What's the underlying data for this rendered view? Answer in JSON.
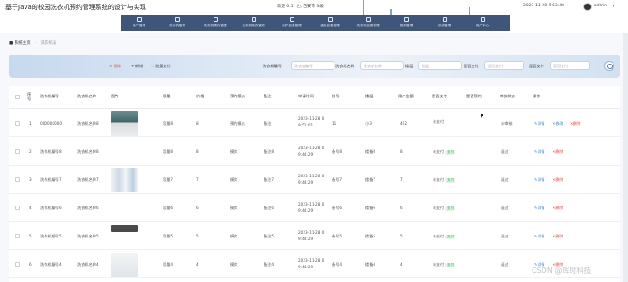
{
  "app": {
    "title": "基于Java的校园洗衣机预约管理系统的设计与实现",
    "user_info": "欢迎 0.1° 🌥 西安市 3级",
    "datetime": "2023-11-28 9:53:40",
    "user": "admin",
    "caret": "▾"
  },
  "nav": [
    {
      "label": "用户管理"
    },
    {
      "label": "洗衣机管理"
    },
    {
      "label": "洗衣机预约管理"
    },
    {
      "label": "洗衣机取衣管理"
    },
    {
      "label": "维护信息管理"
    },
    {
      "label": "通知信息管理"
    },
    {
      "label": "洗衣机信息管理"
    },
    {
      "label": "报修管理"
    },
    {
      "label": "系统管理"
    },
    {
      "label": "用户中心"
    }
  ],
  "breadcrumb": {
    "home": "系统主页",
    "current": "洗衣机表"
  },
  "actions": {
    "delete": "删除",
    "add": "新增",
    "pay": "批量支付"
  },
  "filters": [
    {
      "label": "洗衣机编号",
      "placeholder": "洗衣机编号"
    },
    {
      "label": "洗衣机名称",
      "placeholder": "洗衣机名称"
    },
    {
      "label": "楼层",
      "placeholder": "楼层"
    },
    {
      "label": "是否支付",
      "placeholder": "是否支付"
    },
    {
      "label": "是否支付",
      "placeholder": "是否支付"
    }
  ],
  "table": {
    "headers": [
      "序号",
      "洗衣机编号",
      "洗衣机名称",
      "图片",
      "容量",
      "价格",
      "预约模式",
      "备注",
      "申请时间",
      "楼号",
      "楼层",
      "用户金额",
      "是否支付",
      "是否预约",
      "审核状态",
      "操作"
    ],
    "rows": [
      {
        "no": "1",
        "code": "000000000",
        "name": "洗衣机名称8",
        "capacity": "容量8",
        "price": "8",
        "mode": "预约模式",
        "remark": "备注",
        "time": [
          "2023-11-28 0",
          "9:51:01"
        ],
        "building": "11",
        "floor": "小3",
        "amount": "492",
        "paid": "未支付",
        "paid_pill": "",
        "booked": "",
        "status": "未审核",
        "ops": [
          "详情",
          "修改",
          "删除"
        ]
      },
      {
        "no": "2",
        "code": "洗衣机编号8",
        "name": "洗衣机名称8",
        "capacity": "容量8",
        "price": "8",
        "mode": "模次",
        "remark": "备注8",
        "time": [
          "2023-11-28 0",
          "9:44:29"
        ],
        "building": "备号8",
        "floor": "楼备8",
        "amount": "8",
        "paid": "未支付",
        "paid_pill": "支付",
        "booked": "",
        "status": "通过",
        "ops": [
          "详情",
          "删除"
        ]
      },
      {
        "no": "3",
        "code": "洗衣机编号7",
        "name": "洗衣机名称7",
        "capacity": "容量7",
        "price": "7",
        "mode": "模次",
        "remark": "备注7",
        "time": [
          "2023-11-28 0",
          "9:44:29"
        ],
        "building": "备号7",
        "floor": "楼备7",
        "amount": "7",
        "paid": "未支付",
        "paid_pill": "支付",
        "booked": "",
        "status": "通过",
        "ops": [
          "详情",
          "删除"
        ]
      },
      {
        "no": "4",
        "code": "洗衣机编号6",
        "name": "洗衣机名称6",
        "capacity": "容量6",
        "price": "6",
        "mode": "模次",
        "remark": "备注6",
        "time": [
          "2023-11-28 0",
          "9:44:29"
        ],
        "building": "备号6",
        "floor": "楼备6",
        "amount": "6",
        "paid": "未支付",
        "paid_pill": "支付",
        "booked": "",
        "status": "通过",
        "ops": [
          "详情",
          "删除"
        ]
      },
      {
        "no": "5",
        "code": "洗衣机编号5",
        "name": "洗衣机名称5",
        "capacity": "容量5",
        "price": "5",
        "mode": "模次",
        "remark": "备注5",
        "time": [
          "2023-11-28 0",
          "9:44:29"
        ],
        "building": "备号5",
        "floor": "楼备5",
        "amount": "5",
        "paid": "未支付",
        "paid_pill": "支付",
        "booked": "",
        "status": "通过",
        "ops": [
          "详情",
          "删除"
        ]
      },
      {
        "no": "6",
        "code": "洗衣机编号4",
        "name": "洗衣机名称4",
        "capacity": "容量4",
        "price": "4",
        "mode": "模次",
        "remark": "备注4",
        "time": [
          "2023-11-28 0",
          "9:44:29"
        ],
        "building": "备号4",
        "floor": "楼备4",
        "amount": "4",
        "paid": "未支付",
        "paid_pill": "支付",
        "booked": "",
        "status": "通过",
        "ops": [
          "详情",
          "删除"
        ]
      }
    ]
  },
  "watermark": "CSDN @辉时科技",
  "colors": {
    "nav_bg": "#3f557a",
    "accent": "#3b82c4",
    "danger": "#e04b4b",
    "success": "#2aa35a"
  }
}
